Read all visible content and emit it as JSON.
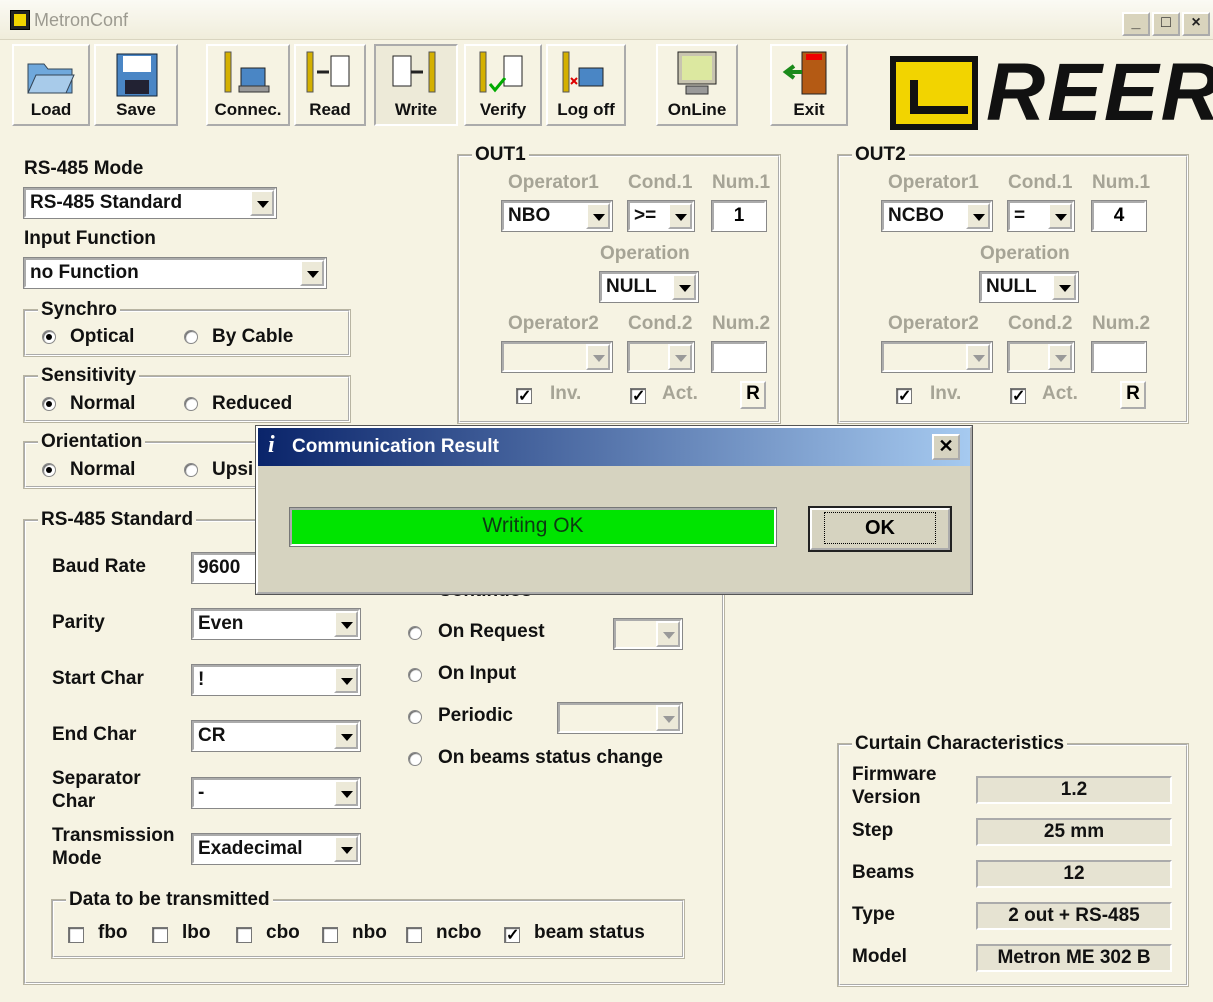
{
  "window": {
    "title": "MetronConf"
  },
  "toolbar": {
    "load": "Load",
    "save": "Save",
    "connect": "Connec.",
    "read": "Read",
    "write": "Write",
    "verify": "Verify",
    "logoff": "Log off",
    "online": "OnLine",
    "exit": "Exit"
  },
  "brand": {
    "logo_text": "REER"
  },
  "left": {
    "rs485_mode_label": "RS-485 Mode",
    "rs485_mode_value": "RS-485 Standard",
    "input_function_label": "Input Function",
    "input_function_value": "no Function",
    "synchro": {
      "title": "Synchro",
      "opt1": "Optical",
      "opt2": "By Cable"
    },
    "sensitivity": {
      "title": "Sensitivity",
      "opt1": "Normal",
      "opt2": "Reduced"
    },
    "orientation": {
      "title": "Orientation",
      "opt1": "Normal",
      "opt2": "Upsi"
    }
  },
  "out1": {
    "title": "OUT1",
    "op1_label": "Operator1",
    "cond1_label": "Cond.1",
    "num1_label": "Num.1",
    "op1": "NBO",
    "cond1": ">=",
    "num1": "1",
    "operation_label": "Operation",
    "operation": "NULL",
    "op2_label": "Operator2",
    "cond2_label": "Cond.2",
    "num2_label": "Num.2",
    "inv": "Inv.",
    "act": "Act.",
    "r": "R"
  },
  "out2": {
    "title": "OUT2",
    "op1_label": "Operator1",
    "cond1_label": "Cond.1",
    "num1_label": "Num.1",
    "op1": "NCBO",
    "cond1": "=",
    "num1": "4",
    "operation_label": "Operation",
    "operation": "NULL",
    "op2_label": "Operator2",
    "cond2_label": "Cond.2",
    "num2_label": "Num.2",
    "inv": "Inv.",
    "act": "Act.",
    "r": "R"
  },
  "rs485": {
    "title": "RS-485 Standard",
    "baud_label": "Baud Rate",
    "baud": "9600",
    "parity_label": "Parity",
    "parity": "Even",
    "start_label": "Start Char",
    "start": "!",
    "end_label": "End Char",
    "end": "CR",
    "sep_label1": "Separator",
    "sep_label2": "Char",
    "sep": "-",
    "tx_label1": "Transmission",
    "tx_label2": "Mode",
    "tx": "Exadecimal",
    "continuos": "Continuos",
    "on_request": "On Request",
    "on_input": "On Input",
    "periodic": "Periodic",
    "on_beams": "On beams status change",
    "data_title": "Data to be transmitted",
    "fbo": "fbo",
    "lbo": "lbo",
    "cbo": "cbo",
    "nbo": "nbo",
    "ncbo": "ncbo",
    "beam_status": "beam status"
  },
  "curtain": {
    "title": "Curtain Characteristics",
    "fw_label1": "Firmware",
    "fw_label2": "Version",
    "fw": "1.2",
    "step_label": "Step",
    "step": "25 mm",
    "beams_label": "Beams",
    "beams": "12",
    "type_label": "Type",
    "type": "2 out + RS-485",
    "model_label": "Model",
    "model": "Metron ME 302 B"
  },
  "dialog": {
    "title": "Communication Result",
    "message": "Writing OK",
    "ok": "OK",
    "close": "✕",
    "info_glyph": "i"
  },
  "colors": {
    "progress": "#00E400",
    "titlebar_dialog": "#0A246A",
    "logo_yellow": "#F2D400"
  }
}
